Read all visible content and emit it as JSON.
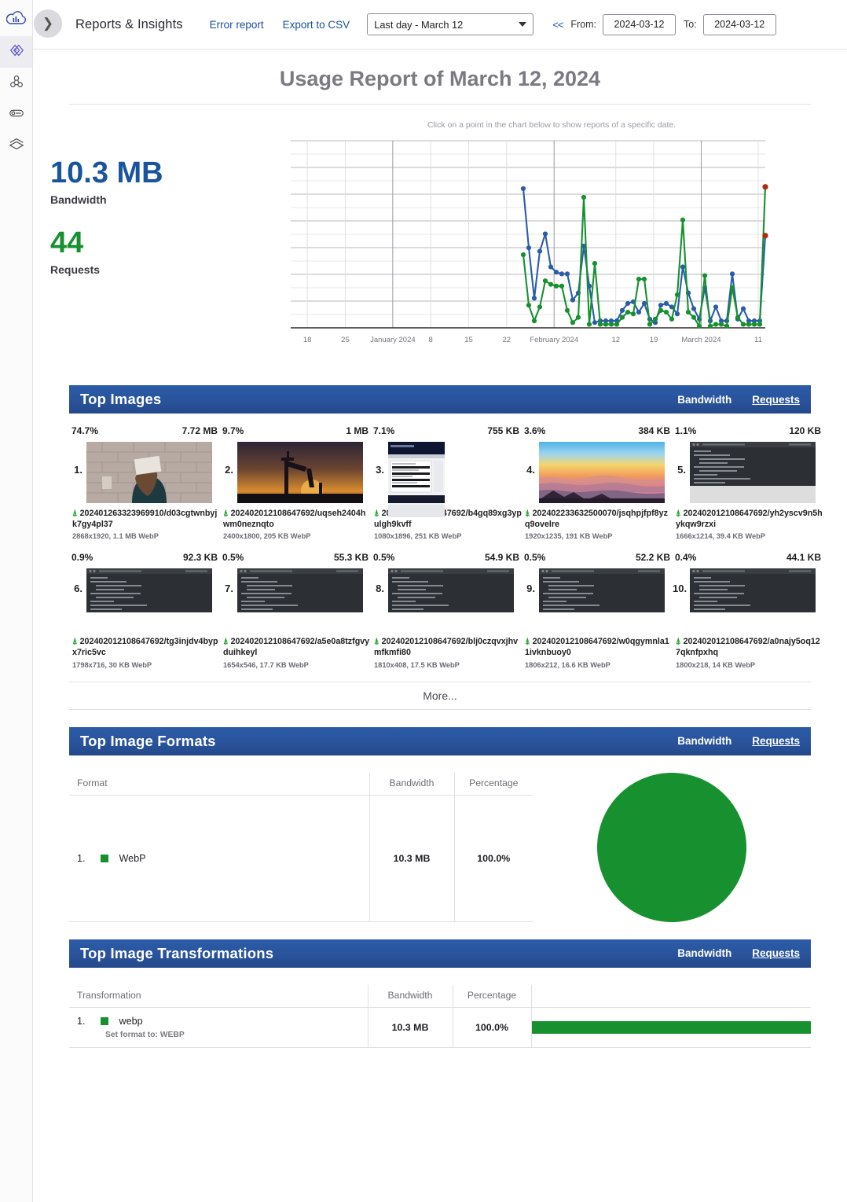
{
  "rail": {
    "logo_icon": "cloudinary-cloud-logo",
    "items": [
      {
        "name": "media-library-icon",
        "active": true
      },
      {
        "name": "transformations-icon",
        "active": false
      },
      {
        "name": "storage-icon",
        "active": false
      },
      {
        "name": "reports-icon",
        "active": false
      }
    ]
  },
  "topbar": {
    "collapse_icon": "chevron-right-icon",
    "app_title": "Reports & Insights",
    "error_report_label": "Error report",
    "export_csv_label": "Export to CSV",
    "range_select_value": "Last day - March 12",
    "prev_nav_label": "<<",
    "from_label": "From:",
    "from_value": "2024-03-12",
    "to_label": "To:",
    "to_value": "2024-03-12"
  },
  "page": {
    "title": "Usage Report of March 12, 2024"
  },
  "stats": {
    "bandwidth_value": "10.3 MB",
    "bandwidth_label": "Bandwidth",
    "requests_value": "44",
    "requests_label": "Requests"
  },
  "chart_hint": "Click on a point in the chart below to show reports of a specific date.",
  "chart_data": {
    "type": "line",
    "title": "",
    "xlabel": "",
    "ylabel": "",
    "grid": true,
    "legend": "none",
    "colors": {
      "bandwidth": "#2b5ca8",
      "requests": "#17912f",
      "highlight": "#b02a10"
    },
    "tick_labels": [
      "18",
      "25",
      "January 2024",
      "8",
      "15",
      "22",
      "February 2024",
      "12",
      "19",
      "March 2024",
      "11"
    ],
    "tick_positions": [
      0.035,
      0.115,
      0.215,
      0.295,
      0.375,
      0.455,
      0.555,
      0.685,
      0.765,
      0.865,
      0.985
    ],
    "x_start_fraction": 0.49,
    "series": [
      {
        "name": "Bandwidth",
        "color": "#2b5ca8",
        "values": [
          0.8,
          0.46,
          0.17,
          0.44,
          0.54,
          0.35,
          0.32,
          0.31,
          0.31,
          0.16,
          0.2,
          0.47,
          0.24,
          0.03,
          0.04,
          0.04,
          0.04,
          0.04,
          0.1,
          0.14,
          0.15,
          0.09,
          0.14,
          0.05,
          0.03,
          0.13,
          0.14,
          0.12,
          0.08,
          0.35,
          0.2,
          0.11,
          0.05,
          0.23,
          0.04,
          0.12,
          0.04,
          0.04,
          0.31,
          0.05,
          0.11,
          0.04,
          0.04,
          0.04,
          0.53
        ]
      },
      {
        "name": "Requests",
        "color": "#17912f",
        "values": [
          0.42,
          0.13,
          0.04,
          0.12,
          0.27,
          0.25,
          0.24,
          0.24,
          0.1,
          0.03,
          0.06,
          0.75,
          0.02,
          0.37,
          0.02,
          0.02,
          0.02,
          0.02,
          0.06,
          0.09,
          0.08,
          0.28,
          0.28,
          0.02,
          0.05,
          0.1,
          0.09,
          0.05,
          0.19,
          0.62,
          0.09,
          0.06,
          0.01,
          0.3,
          0.01,
          0.02,
          0.02,
          0.01,
          0.23,
          0.06,
          0.02,
          0.02,
          0.02,
          0.02,
          0.81
        ]
      }
    ],
    "highlight_points": [
      {
        "series": "Requests",
        "index": 44,
        "color": "#b02a10"
      },
      {
        "series": "Bandwidth",
        "index": 44,
        "color": "#b02a10"
      }
    ]
  },
  "top_images": {
    "title": "Top Images",
    "bandwidth_tab": "Bandwidth",
    "requests_tab": "Requests",
    "more_label": "More...",
    "items": [
      {
        "rank": "1.",
        "pct": "74.7%",
        "size": "7.72 MB",
        "pct_fill": 1.0,
        "name": "202401263323969910/d03cgtwnbyjk7gy4pl37",
        "meta": "2868x1920, 1.1 MB WebP",
        "thumb": "photo-woman-wall"
      },
      {
        "rank": "2.",
        "pct": "9.7%",
        "size": "1 MB",
        "pct_fill": 0.17,
        "name": "202402012108647692/uqseh2404hwm0neznqto",
        "meta": "2400x1800, 205 KB WebP",
        "thumb": "photo-crane-sunset"
      },
      {
        "rank": "3.",
        "pct": "7.1%",
        "size": "755 KB",
        "pct_fill": 0.14,
        "name": "202402012108647692/b4gq89xg3ypulgh9kvff",
        "meta": "1080x1896, 251 KB WebP",
        "thumb": "screenshot-page"
      },
      {
        "rank": "4.",
        "pct": "3.6%",
        "size": "384 KB",
        "pct_fill": 0.12,
        "name": "202402233632500070/jsqhpjfpf8yzq9ovelre",
        "meta": "1920x1235, 191 KB WebP",
        "thumb": "photo-mountain-sunset"
      },
      {
        "rank": "5.",
        "pct": "1.1%",
        "size": "120 KB",
        "pct_fill": 0.11,
        "name": "202402012108647692/yh2yscv9n5hykqw9rzxi",
        "meta": "1666x1214, 39.4 KB WebP",
        "thumb": "terminal-dark"
      },
      {
        "rank": "6.",
        "pct": "0.9%",
        "size": "92.3 KB",
        "pct_fill": 0.1,
        "name": "202402012108647692/tg3injdv4bypx7ric5vc",
        "meta": "1798x716, 30 KB WebP",
        "thumb": "terminal-dark"
      },
      {
        "rank": "7.",
        "pct": "0.5%",
        "size": "55.3 KB",
        "pct_fill": 0.1,
        "name": "202402012108647692/a5e0a8tzfgvyduihkeyl",
        "meta": "1654x546, 17.7 KB WebP",
        "thumb": "terminal-dark"
      },
      {
        "rank": "8.",
        "pct": "0.5%",
        "size": "54.9 KB",
        "pct_fill": 0.1,
        "name": "202402012108647692/blj0czqvxjhvmfkmfi80",
        "meta": "1810x408, 17.5 KB WebP",
        "thumb": "terminal-dark"
      },
      {
        "rank": "9.",
        "pct": "0.5%",
        "size": "52.2 KB",
        "pct_fill": 0.1,
        "name": "202402012108647692/w0qgymnla11ivknbuoy0",
        "meta": "1806x212, 16.6 KB WebP",
        "thumb": "terminal-dark"
      },
      {
        "rank": "10.",
        "pct": "0.4%",
        "size": "44.1 KB",
        "pct_fill": 0.1,
        "name": "202402012108647692/a0najy5oq127qknfpxhq",
        "meta": "1800x218, 14 KB WebP",
        "thumb": "terminal-dark"
      }
    ]
  },
  "top_formats": {
    "title": "Top Image Formats",
    "bandwidth_tab": "Bandwidth",
    "requests_tab": "Requests",
    "columns": [
      "Format",
      "Bandwidth",
      "Percentage"
    ],
    "rows": [
      {
        "rank": "1.",
        "label": "WebP",
        "bandwidth": "10.3 MB",
        "percentage": "100.0%",
        "color": "#17912f"
      }
    ],
    "pie": {
      "type": "pie",
      "slices": [
        {
          "label": "WebP",
          "value": 100.0,
          "color": "#17912f"
        }
      ]
    }
  },
  "top_transformations": {
    "title": "Top Image Transformations",
    "bandwidth_tab": "Bandwidth",
    "requests_tab": "Requests",
    "columns": [
      "Transformation",
      "Bandwidth",
      "Percentage",
      ""
    ],
    "rows": [
      {
        "rank": "1.",
        "label": "webp",
        "sub": "Set format to: WEBP",
        "bandwidth": "10.3 MB",
        "percentage": "100.0%",
        "bar_pct": 100,
        "color": "#17912f"
      }
    ]
  }
}
